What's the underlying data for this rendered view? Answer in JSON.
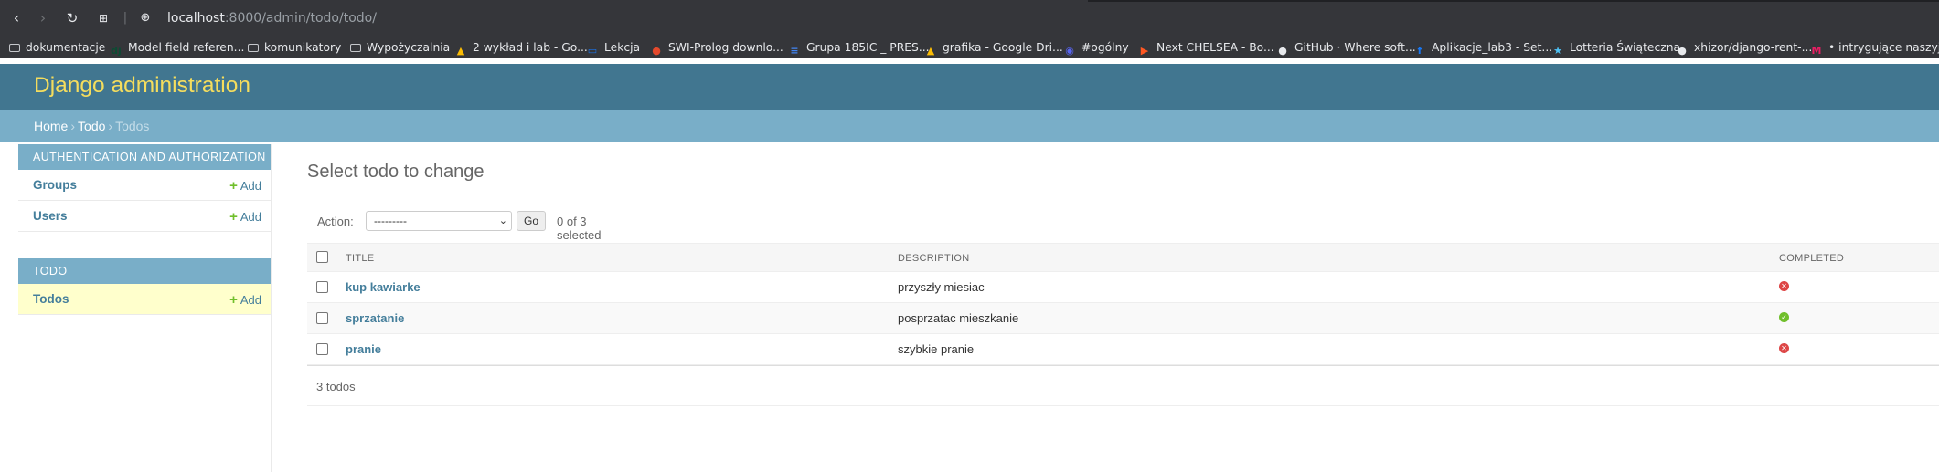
{
  "browser": {
    "url_host": "localhost",
    "url_path": ":8000/admin/todo/todo/",
    "icons": [
      "back-icon",
      "forward-icon",
      "reload-icon",
      "tab-search-icon",
      "site-info-icon"
    ]
  },
  "bookmarks": [
    {
      "label": "dokumentacje",
      "icon": "folder-icon",
      "color": "#c5c7cb"
    },
    {
      "label": "Model field referen...",
      "icon": "django-icon",
      "color": "#0c4b33"
    },
    {
      "label": "komunikatory",
      "icon": "folder-icon",
      "color": "#c5c7cb"
    },
    {
      "label": "Wypożyczalnia",
      "icon": "folder-icon",
      "color": "#c5c7cb"
    },
    {
      "label": "2 wykład i lab - Go...",
      "icon": "google-drive-icon",
      "color": "#fbbc04"
    },
    {
      "label": "Lekcja",
      "icon": "lekcja-icon",
      "color": "#1a73e8"
    },
    {
      "label": "SWI-Prolog downlo...",
      "icon": "swi-prolog-icon",
      "color": "#e5492c"
    },
    {
      "label": "Grupa 185IC _ PRES...",
      "icon": "google-docs-icon",
      "color": "#4285f4"
    },
    {
      "label": "grafika - Google Dri...",
      "icon": "google-drive-icon",
      "color": "#fbbc04"
    },
    {
      "label": "#ogólny",
      "icon": "discord-icon",
      "color": "#5865f2"
    },
    {
      "label": "Next CHELSEA - Bo...",
      "icon": "play-icon",
      "color": "#ff5722"
    },
    {
      "label": "GitHub · Where soft...",
      "icon": "github-icon",
      "color": "#e8eaed"
    },
    {
      "label": "Aplikacje_lab3 - Set...",
      "icon": "facebook-icon",
      "color": "#1877f2"
    },
    {
      "label": "Lotteria Świąteczna",
      "icon": "star-icon",
      "color": "#4fc3f7"
    },
    {
      "label": "xhizor/django-rent-...",
      "icon": "github-icon",
      "color": "#e8eaed"
    },
    {
      "label": "• intrygujące naszyj...",
      "icon": "m-icon",
      "color": "#e91e63"
    }
  ],
  "admin": {
    "branding": "Django administration",
    "breadcrumbs": {
      "home": "Home",
      "app": "Todo",
      "current": "Todos",
      "sep": "›"
    }
  },
  "sidebar": {
    "modules": [
      {
        "caption": "AUTHENTICATION AND AUTHORIZATION",
        "rows": [
          {
            "label": "Groups",
            "add": "Add",
            "active": false
          },
          {
            "label": "Users",
            "add": "Add",
            "active": false
          }
        ]
      },
      {
        "caption": "TODO",
        "rows": [
          {
            "label": "Todos",
            "add": "Add",
            "active": true
          }
        ]
      }
    ]
  },
  "main": {
    "title": "Select todo to change",
    "action_label": "Action:",
    "action_selected": "---------",
    "go_label": "Go",
    "selected_count": "0 of 3 selected",
    "columns": [
      "TITLE",
      "DESCRIPTION",
      "COMPLETED"
    ],
    "rows": [
      {
        "title": "kup kawiarke",
        "description": "przyszły miesiac",
        "completed": false
      },
      {
        "title": "sprzatanie",
        "description": "posprzatac mieszkanie",
        "completed": true
      },
      {
        "title": "pranie",
        "description": "szybkie pranie",
        "completed": false
      }
    ],
    "paginator": "3 todos"
  },
  "colors": {
    "header": "#417690",
    "branding": "#f5dd5d",
    "breadcrumbs": "#79aec8",
    "link": "#447e9b",
    "add": "#70bf2b",
    "yes": "#70bf2b",
    "no": "#dd4646",
    "active_row": "#ffffcc"
  }
}
